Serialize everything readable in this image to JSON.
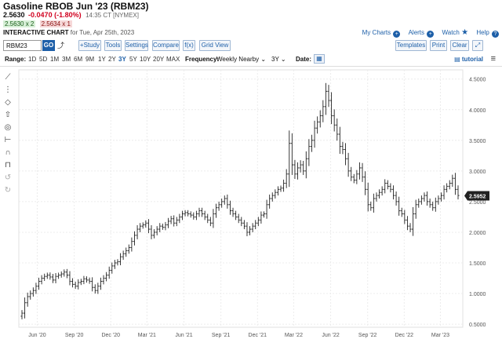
{
  "header": {
    "title": "Gasoline RBOB Jun '23 (RBM23)",
    "last": "2.5630",
    "change": "-0.0470 (-1.80%)",
    "time": "14:35 CT [NYMEX]",
    "bid": "2.5630 x 2",
    "ask": "2.5634 x 1",
    "chart_label": "INTERACTIVE CHART",
    "chart_date": "for Tue, Apr 25th, 2023"
  },
  "links": {
    "my_charts": "My Charts",
    "alerts": "Alerts",
    "watch": "Watch",
    "help": "Help"
  },
  "toolbar": {
    "symbol": "RBM23",
    "go": "GO",
    "study": "+Study",
    "tools": "Tools",
    "settings": "Settings",
    "compare": "Compare",
    "fx": "f(x)",
    "grid_view": "Grid View",
    "templates": "Templates",
    "print": "Print",
    "clear": "Clear",
    "expand": "⤢"
  },
  "range_bar": {
    "range_label": "Range:",
    "ranges": [
      "1D",
      "5D",
      "1M",
      "3M",
      "6M",
      "9M",
      "1Y",
      "2Y",
      "3Y",
      "5Y",
      "10Y",
      "20Y",
      "MAX"
    ],
    "active": "3Y",
    "frequency_label": "Frequency:",
    "frequency": "Weekly Nearby",
    "period": "3Y",
    "date_label": "Date:",
    "tutorial": "tutorial"
  },
  "chart_data": {
    "type": "ohlc",
    "x_ticks": [
      "Jun '20",
      "Sep '20",
      "Dec '20",
      "Mar '21",
      "Jun '21",
      "Sep '21",
      "Dec '21",
      "Mar '22",
      "Jun '22",
      "Sep '22",
      "Dec '22",
      "Mar '23"
    ],
    "y_ticks": [
      "4.5000",
      "4.0000",
      "3.5000",
      "3.0000",
      "2.5000",
      "2.0000",
      "1.5000",
      "1.0000",
      "0.5000"
    ],
    "ylim": [
      0.45,
      4.65
    ],
    "last_label": "2.5952",
    "series": [
      {
        "name": "RBM23",
        "x": [
          "2020-05-08",
          "2020-05-15",
          "2020-05-22",
          "2020-05-29",
          "2020-06-05",
          "2020-06-12",
          "2020-06-19",
          "2020-06-26",
          "2020-07-03",
          "2020-07-10",
          "2020-07-17",
          "2020-07-24",
          "2020-07-31",
          "2020-08-07",
          "2020-08-14",
          "2020-08-21",
          "2020-08-28",
          "2020-09-04",
          "2020-09-11",
          "2020-09-18",
          "2020-09-25",
          "2020-10-02",
          "2020-10-09",
          "2020-10-16",
          "2020-10-23",
          "2020-10-30",
          "2020-11-06",
          "2020-11-13",
          "2020-11-20",
          "2020-11-27",
          "2020-12-04",
          "2020-12-11",
          "2020-12-18",
          "2020-12-25",
          "2021-01-01",
          "2021-01-08",
          "2021-01-15",
          "2021-01-22",
          "2021-01-29",
          "2021-02-05",
          "2021-02-12",
          "2021-02-19",
          "2021-02-26",
          "2021-03-05",
          "2021-03-12",
          "2021-03-19",
          "2021-03-26",
          "2021-04-02",
          "2021-04-09",
          "2021-04-16",
          "2021-04-23",
          "2021-04-30",
          "2021-05-07",
          "2021-05-14",
          "2021-05-21",
          "2021-05-28",
          "2021-06-04",
          "2021-06-11",
          "2021-06-18",
          "2021-06-25",
          "2021-07-02",
          "2021-07-09",
          "2021-07-16",
          "2021-07-23",
          "2021-07-30",
          "2021-08-06",
          "2021-08-13",
          "2021-08-20",
          "2021-08-27",
          "2021-09-03",
          "2021-09-10",
          "2021-09-17",
          "2021-09-24",
          "2021-10-01",
          "2021-10-08",
          "2021-10-15",
          "2021-10-22",
          "2021-10-29",
          "2021-11-05",
          "2021-11-12",
          "2021-11-19",
          "2021-11-26",
          "2021-12-03",
          "2021-12-10",
          "2021-12-17",
          "2021-12-24",
          "2021-12-31",
          "2022-01-07",
          "2022-01-14",
          "2022-01-21",
          "2022-01-28",
          "2022-02-04",
          "2022-02-11",
          "2022-02-18",
          "2022-02-25",
          "2022-03-04",
          "2022-03-11",
          "2022-03-18",
          "2022-03-25",
          "2022-04-01",
          "2022-04-08",
          "2022-04-15",
          "2022-04-22",
          "2022-04-29",
          "2022-05-06",
          "2022-05-13",
          "2022-05-20",
          "2022-05-27",
          "2022-06-03",
          "2022-06-10",
          "2022-06-17",
          "2022-06-24",
          "2022-07-01",
          "2022-07-08",
          "2022-07-15",
          "2022-07-22",
          "2022-07-29",
          "2022-08-05",
          "2022-08-12",
          "2022-08-19",
          "2022-08-26",
          "2022-09-02",
          "2022-09-09",
          "2022-09-16",
          "2022-09-23",
          "2022-09-30",
          "2022-10-07",
          "2022-10-14",
          "2022-10-21",
          "2022-10-28",
          "2022-11-04",
          "2022-11-11",
          "2022-11-18",
          "2022-11-25",
          "2022-12-02",
          "2022-12-09",
          "2022-12-16",
          "2022-12-23",
          "2022-12-30",
          "2023-01-06",
          "2023-01-13",
          "2023-01-20",
          "2023-01-27",
          "2023-02-03",
          "2023-02-10",
          "2023-02-17",
          "2023-02-24",
          "2023-03-03",
          "2023-03-10",
          "2023-03-17",
          "2023-03-24",
          "2023-03-31",
          "2023-04-07",
          "2023-04-14",
          "2023-04-21",
          "2023-04-28"
        ],
        "close": [
          0.68,
          0.85,
          0.95,
          1.0,
          1.05,
          1.12,
          1.2,
          1.25,
          1.28,
          1.3,
          1.27,
          1.22,
          1.28,
          1.3,
          1.32,
          1.35,
          1.3,
          1.2,
          1.15,
          1.12,
          1.18,
          1.2,
          1.24,
          1.22,
          1.2,
          1.1,
          1.05,
          1.12,
          1.2,
          1.25,
          1.3,
          1.38,
          1.45,
          1.5,
          1.52,
          1.6,
          1.65,
          1.7,
          1.75,
          1.85,
          1.95,
          2.05,
          2.1,
          2.12,
          2.15,
          2.05,
          1.95,
          2.0,
          2.05,
          2.1,
          2.08,
          2.12,
          2.18,
          2.22,
          2.15,
          2.2,
          2.25,
          2.3,
          2.32,
          2.3,
          2.28,
          2.25,
          2.3,
          2.35,
          2.3,
          2.25,
          2.2,
          2.15,
          2.3,
          2.4,
          2.45,
          2.5,
          2.55,
          2.45,
          2.35,
          2.3,
          2.25,
          2.2,
          2.15,
          2.1,
          2.0,
          2.05,
          2.1,
          2.15,
          2.2,
          2.28,
          2.3,
          2.45,
          2.55,
          2.6,
          2.65,
          2.7,
          2.72,
          2.8,
          2.95,
          3.45,
          3.1,
          2.95,
          3.05,
          3.1,
          3.0,
          3.2,
          3.4,
          3.5,
          3.7,
          3.8,
          3.9,
          4.05,
          4.3,
          4.15,
          3.9,
          3.75,
          3.6,
          3.4,
          3.35,
          3.2,
          3.0,
          2.9,
          2.85,
          2.95,
          3.05,
          2.9,
          2.7,
          2.45,
          2.4,
          2.55,
          2.6,
          2.65,
          2.7,
          2.8,
          2.75,
          2.7,
          2.6,
          2.5,
          2.35,
          2.3,
          2.2,
          2.1,
          2.05,
          2.3,
          2.45,
          2.5,
          2.55,
          2.6,
          2.5,
          2.45,
          2.4,
          2.5,
          2.55,
          2.6,
          2.7,
          2.75,
          2.8,
          2.88,
          2.7,
          2.6
        ]
      }
    ]
  }
}
